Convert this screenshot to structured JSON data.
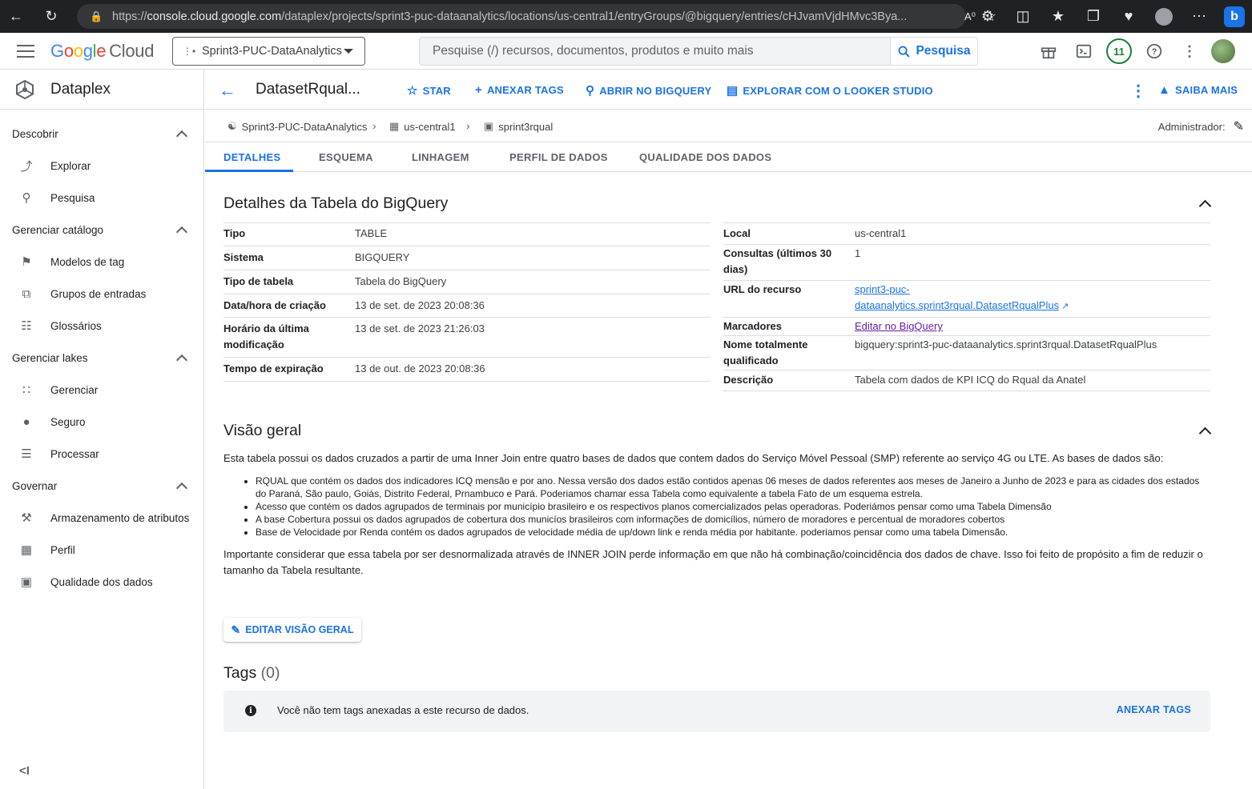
{
  "browser": {
    "url_prefix": "https://",
    "url_host": "console.cloud.google.com",
    "url_path": "/dataplex/projects/sprint3-puc-dataanalytics/locations/us-central1/entryGroups/@bigquery/entries/cHJvamVjdHMvc3Bya..."
  },
  "topbar": {
    "logo_g": "G",
    "logo_o1": "o",
    "logo_o2": "o",
    "logo_g2": "g",
    "logo_l": "l",
    "logo_e": "e",
    "logo_cloud": "Cloud",
    "project": "Sprint3-PUC-DataAnalytics",
    "search_placeholder": "Pesquise (/) recursos, documentos, produtos e muito mais",
    "search_button": "Pesquisa",
    "notifications_count": "11"
  },
  "sidebar": {
    "product": "Dataplex",
    "sections": [
      {
        "label": "Descobrir",
        "items": [
          {
            "label": "Explorar",
            "icon": "explore-icon"
          },
          {
            "label": "Pesquisa",
            "icon": "search-icon"
          }
        ]
      },
      {
        "label": "Gerenciar catálogo",
        "items": [
          {
            "label": "Modelos de tag",
            "icon": "tag-icon"
          },
          {
            "label": "Grupos de entradas",
            "icon": "entry-groups-icon"
          },
          {
            "label": "Glossários",
            "icon": "book-icon"
          }
        ]
      },
      {
        "label": "Gerenciar lakes",
        "items": [
          {
            "label": "Gerenciar",
            "icon": "grid-icon"
          },
          {
            "label": "Seguro",
            "icon": "person-icon"
          },
          {
            "label": "Processar",
            "icon": "list-icon"
          }
        ]
      },
      {
        "label": "Governar",
        "items": [
          {
            "label": "Armazenamento de atributos",
            "icon": "gavel-icon"
          },
          {
            "label": "Perfil",
            "icon": "profile-icon"
          },
          {
            "label": "Qualidade dos dados",
            "icon": "quality-icon"
          }
        ]
      }
    ],
    "collapse_label": "<I"
  },
  "header": {
    "title": "DatasetRqual...",
    "actions": {
      "star": "STAR",
      "attach_tags": "ANEXAR TAGS",
      "open_bigquery": "ABRIR NO BIGQUERY",
      "looker": "EXPLORAR COM O LOOKER STUDIO",
      "learn_more": "SAIBA MAIS"
    }
  },
  "breadcrumb": {
    "project": "Sprint3-PUC-DataAnalytics",
    "location": "us-central1",
    "dataset": "sprint3rqual",
    "admin_label": "Administrador:"
  },
  "tabs": [
    "DETALHES",
    "ESQUEMA",
    "LINHAGEM",
    "PERFIL DE DADOS",
    "QUALIDADE DOS DADOS"
  ],
  "details": {
    "title": "Detalhes da Tabela do BigQuery",
    "left": [
      {
        "k": "Tipo",
        "v": "TABLE"
      },
      {
        "k": "Sistema",
        "v": "BIGQUERY"
      },
      {
        "k": "Tipo de tabela",
        "v": "Tabela do BigQuery"
      },
      {
        "k": "Data/hora de criação",
        "v": "13 de set. de 2023 20:08:36"
      },
      {
        "k": "Horário da última modificação",
        "v": "13 de set. de 2023 21:26:03"
      },
      {
        "k": "Tempo de expiração",
        "v": "13 de out. de 2023 20:08:36"
      }
    ],
    "right": {
      "local_k": "Local",
      "local_v": "us-central1",
      "queries_k": "Consultas (últimos 30 dias)",
      "queries_v": "1",
      "url_k": "URL do recurso",
      "url_v": "sprint3-puc-dataanalytics.sprint3rqual.DatasetRqualPlus",
      "markers_k": "Marcadores",
      "markers_v": "Editar no BigQuery",
      "fqn_k": "Nome totalmente qualificado",
      "fqn_v": "bigquery:sprint3-puc-dataanalytics.sprint3rqual.DatasetRqualPlus",
      "desc_k": "Descrição",
      "desc_v": "Tabela com dados de KPI ICQ do Rqual da Anatel"
    }
  },
  "overview": {
    "title": "Visão geral",
    "intro": "Esta tabela possui os dados cruzados a partir de uma Inner Join entre quatro bases de dados que contem dados do Serviço Móvel Pessoal (SMP) referente ao serviço 4G ou LTE. As bases de dados são:",
    "bullets": [
      "RQUAL que contém os dados dos indicadores ICQ mensão e por ano. Nessa versão dos dados estão contidos apenas 06 meses de dados referentes aos meses de Janeiro a Junho de 2023 e para as cidades dos estados do Paraná, São paulo, Goiás, Distrito Federal, Prnambuco e Pará. Poderiamos chamar essa Tabela como equivalente a tabela Fato de um esquema estrela.",
      "Acesso que contém os dados agrupados de terminais por município brasileiro e os respectivos planos comercializados pelas operadoras. Poderiámos pensar como uma Tabela Dimensão",
      "A base Cobertura possui os dados agrupados de cobertura dos municíos brasileiros com informações de domicílios, número de moradores e percentual de moradores cobertos",
      "Base de Velocidade por Renda contém os dados agrupados de velocidade média de up/down link e renda média por habitante. poderiamos pensar como uma tabela Dimensão."
    ],
    "note": "Importante considerar que essa tabela por ser desnormalizada através de INNER JOIN perde informação em que não há combinação/coincidência dos dados de chave. Isso foi feito de propósito a fim de reduzir o tamanho da Tabela resultante.",
    "edit_button": "EDITAR VISÃO GERAL"
  },
  "tags": {
    "title": "Tags",
    "count": "(0)",
    "message": "Você não tem tags anexadas a este recurso de dados.",
    "attach": "ANEXAR TAGS"
  }
}
